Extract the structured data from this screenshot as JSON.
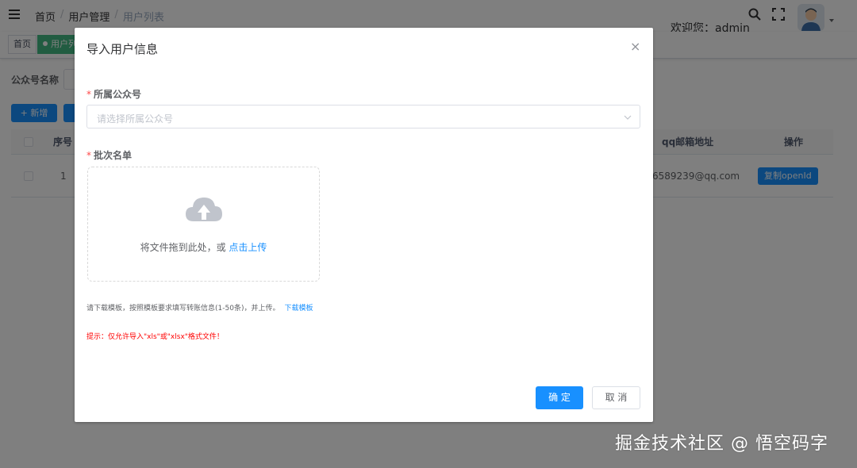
{
  "navbar": {
    "breadcrumb": [
      "首页",
      "用户管理",
      "用户列表"
    ],
    "breadcrumb_sep": "/",
    "welcome": "欢迎您：admin"
  },
  "tags": {
    "home": "首页",
    "active": "用户列"
  },
  "search": {
    "label": "公众号名称"
  },
  "toolbar": {
    "add_label": "+ 新增"
  },
  "table": {
    "headers": {
      "index": "序号",
      "email": "qq邮箱地址",
      "action": "操作"
    },
    "rows": [
      {
        "index": "1",
        "email": "6589239@qq.com",
        "action": "复制openId"
      }
    ]
  },
  "dialog": {
    "title": "导入用户信息",
    "close": "×",
    "account_label": "所属公众号",
    "account_placeholder": "请选择所属公众号",
    "batch_label": "批次名单",
    "required_mark": "*",
    "upload_text": "将文件拖到此处，或",
    "upload_link": "点击上传",
    "tip_text": "请下载模板，按照模板要求填写转账信息(1-50条)，并上传。",
    "tip_link": "下载模板",
    "warning": "提示：仅允许导入\"xls\"或\"xlsx\"格式文件！",
    "confirm": "确 定",
    "cancel": "取 消"
  },
  "watermark": "掘金技术社区 @ 悟空码字",
  "colors": {
    "primary": "#1890ff",
    "danger": "#ff0000",
    "tag_active": "#42b983",
    "overlay": "rgba(0,0,0,0.5)"
  }
}
